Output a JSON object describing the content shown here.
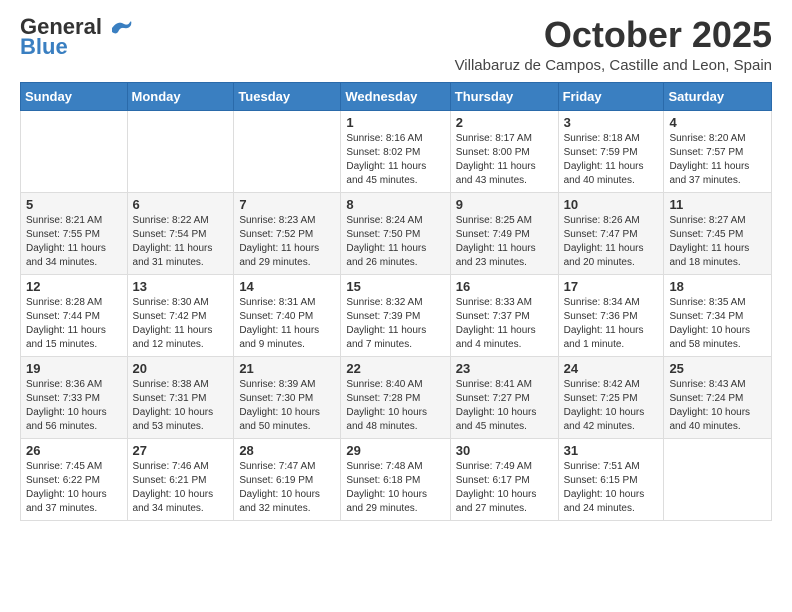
{
  "header": {
    "logo_line1": "General",
    "logo_line2": "Blue",
    "month": "October 2025",
    "location": "Villabaruz de Campos, Castille and Leon, Spain"
  },
  "days_of_week": [
    "Sunday",
    "Monday",
    "Tuesday",
    "Wednesday",
    "Thursday",
    "Friday",
    "Saturday"
  ],
  "weeks": [
    [
      {
        "day": "",
        "info": ""
      },
      {
        "day": "",
        "info": ""
      },
      {
        "day": "",
        "info": ""
      },
      {
        "day": "1",
        "info": "Sunrise: 8:16 AM\nSunset: 8:02 PM\nDaylight: 11 hours and 45 minutes."
      },
      {
        "day": "2",
        "info": "Sunrise: 8:17 AM\nSunset: 8:00 PM\nDaylight: 11 hours and 43 minutes."
      },
      {
        "day": "3",
        "info": "Sunrise: 8:18 AM\nSunset: 7:59 PM\nDaylight: 11 hours and 40 minutes."
      },
      {
        "day": "4",
        "info": "Sunrise: 8:20 AM\nSunset: 7:57 PM\nDaylight: 11 hours and 37 minutes."
      }
    ],
    [
      {
        "day": "5",
        "info": "Sunrise: 8:21 AM\nSunset: 7:55 PM\nDaylight: 11 hours and 34 minutes."
      },
      {
        "day": "6",
        "info": "Sunrise: 8:22 AM\nSunset: 7:54 PM\nDaylight: 11 hours and 31 minutes."
      },
      {
        "day": "7",
        "info": "Sunrise: 8:23 AM\nSunset: 7:52 PM\nDaylight: 11 hours and 29 minutes."
      },
      {
        "day": "8",
        "info": "Sunrise: 8:24 AM\nSunset: 7:50 PM\nDaylight: 11 hours and 26 minutes."
      },
      {
        "day": "9",
        "info": "Sunrise: 8:25 AM\nSunset: 7:49 PM\nDaylight: 11 hours and 23 minutes."
      },
      {
        "day": "10",
        "info": "Sunrise: 8:26 AM\nSunset: 7:47 PM\nDaylight: 11 hours and 20 minutes."
      },
      {
        "day": "11",
        "info": "Sunrise: 8:27 AM\nSunset: 7:45 PM\nDaylight: 11 hours and 18 minutes."
      }
    ],
    [
      {
        "day": "12",
        "info": "Sunrise: 8:28 AM\nSunset: 7:44 PM\nDaylight: 11 hours and 15 minutes."
      },
      {
        "day": "13",
        "info": "Sunrise: 8:30 AM\nSunset: 7:42 PM\nDaylight: 11 hours and 12 minutes."
      },
      {
        "day": "14",
        "info": "Sunrise: 8:31 AM\nSunset: 7:40 PM\nDaylight: 11 hours and 9 minutes."
      },
      {
        "day": "15",
        "info": "Sunrise: 8:32 AM\nSunset: 7:39 PM\nDaylight: 11 hours and 7 minutes."
      },
      {
        "day": "16",
        "info": "Sunrise: 8:33 AM\nSunset: 7:37 PM\nDaylight: 11 hours and 4 minutes."
      },
      {
        "day": "17",
        "info": "Sunrise: 8:34 AM\nSunset: 7:36 PM\nDaylight: 11 hours and 1 minute."
      },
      {
        "day": "18",
        "info": "Sunrise: 8:35 AM\nSunset: 7:34 PM\nDaylight: 10 hours and 58 minutes."
      }
    ],
    [
      {
        "day": "19",
        "info": "Sunrise: 8:36 AM\nSunset: 7:33 PM\nDaylight: 10 hours and 56 minutes."
      },
      {
        "day": "20",
        "info": "Sunrise: 8:38 AM\nSunset: 7:31 PM\nDaylight: 10 hours and 53 minutes."
      },
      {
        "day": "21",
        "info": "Sunrise: 8:39 AM\nSunset: 7:30 PM\nDaylight: 10 hours and 50 minutes."
      },
      {
        "day": "22",
        "info": "Sunrise: 8:40 AM\nSunset: 7:28 PM\nDaylight: 10 hours and 48 minutes."
      },
      {
        "day": "23",
        "info": "Sunrise: 8:41 AM\nSunset: 7:27 PM\nDaylight: 10 hours and 45 minutes."
      },
      {
        "day": "24",
        "info": "Sunrise: 8:42 AM\nSunset: 7:25 PM\nDaylight: 10 hours and 42 minutes."
      },
      {
        "day": "25",
        "info": "Sunrise: 8:43 AM\nSunset: 7:24 PM\nDaylight: 10 hours and 40 minutes."
      }
    ],
    [
      {
        "day": "26",
        "info": "Sunrise: 7:45 AM\nSunset: 6:22 PM\nDaylight: 10 hours and 37 minutes."
      },
      {
        "day": "27",
        "info": "Sunrise: 7:46 AM\nSunset: 6:21 PM\nDaylight: 10 hours and 34 minutes."
      },
      {
        "day": "28",
        "info": "Sunrise: 7:47 AM\nSunset: 6:19 PM\nDaylight: 10 hours and 32 minutes."
      },
      {
        "day": "29",
        "info": "Sunrise: 7:48 AM\nSunset: 6:18 PM\nDaylight: 10 hours and 29 minutes."
      },
      {
        "day": "30",
        "info": "Sunrise: 7:49 AM\nSunset: 6:17 PM\nDaylight: 10 hours and 27 minutes."
      },
      {
        "day": "31",
        "info": "Sunrise: 7:51 AM\nSunset: 6:15 PM\nDaylight: 10 hours and 24 minutes."
      },
      {
        "day": "",
        "info": ""
      }
    ]
  ]
}
